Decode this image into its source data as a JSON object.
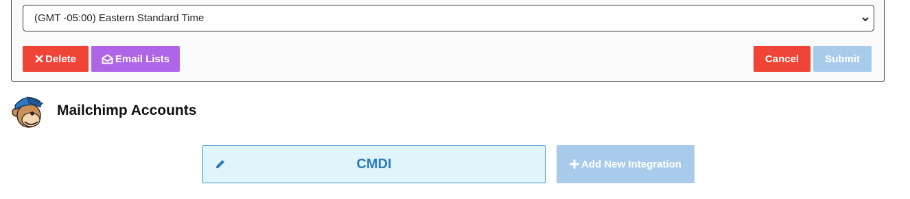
{
  "form": {
    "timezone": {
      "selected": "(GMT -05:00) Eastern Standard Time",
      "icon": "chevron-down-icon"
    },
    "buttons": {
      "delete_label": "Delete",
      "delete_icon": "x-icon",
      "email_lists_label": "Email Lists",
      "email_lists_icon": "envelope-open-icon",
      "cancel_label": "Cancel",
      "submit_label": "Submit"
    }
  },
  "section": {
    "title": "Mailchimp Accounts",
    "logo_icon": "mailchimp-logo-icon"
  },
  "integrations": {
    "items": [
      {
        "label": "CMDI",
        "icon": "pencil-icon"
      }
    ],
    "add_label": "Add New Integration",
    "add_icon": "plus-icon"
  },
  "colors": {
    "danger": "#f04437",
    "purple": "#b064e6",
    "primary_disabled": "#a9cbeb",
    "card_bg": "#e0f4fb",
    "card_border": "#3d8fcf",
    "card_text": "#2b7bbd"
  }
}
